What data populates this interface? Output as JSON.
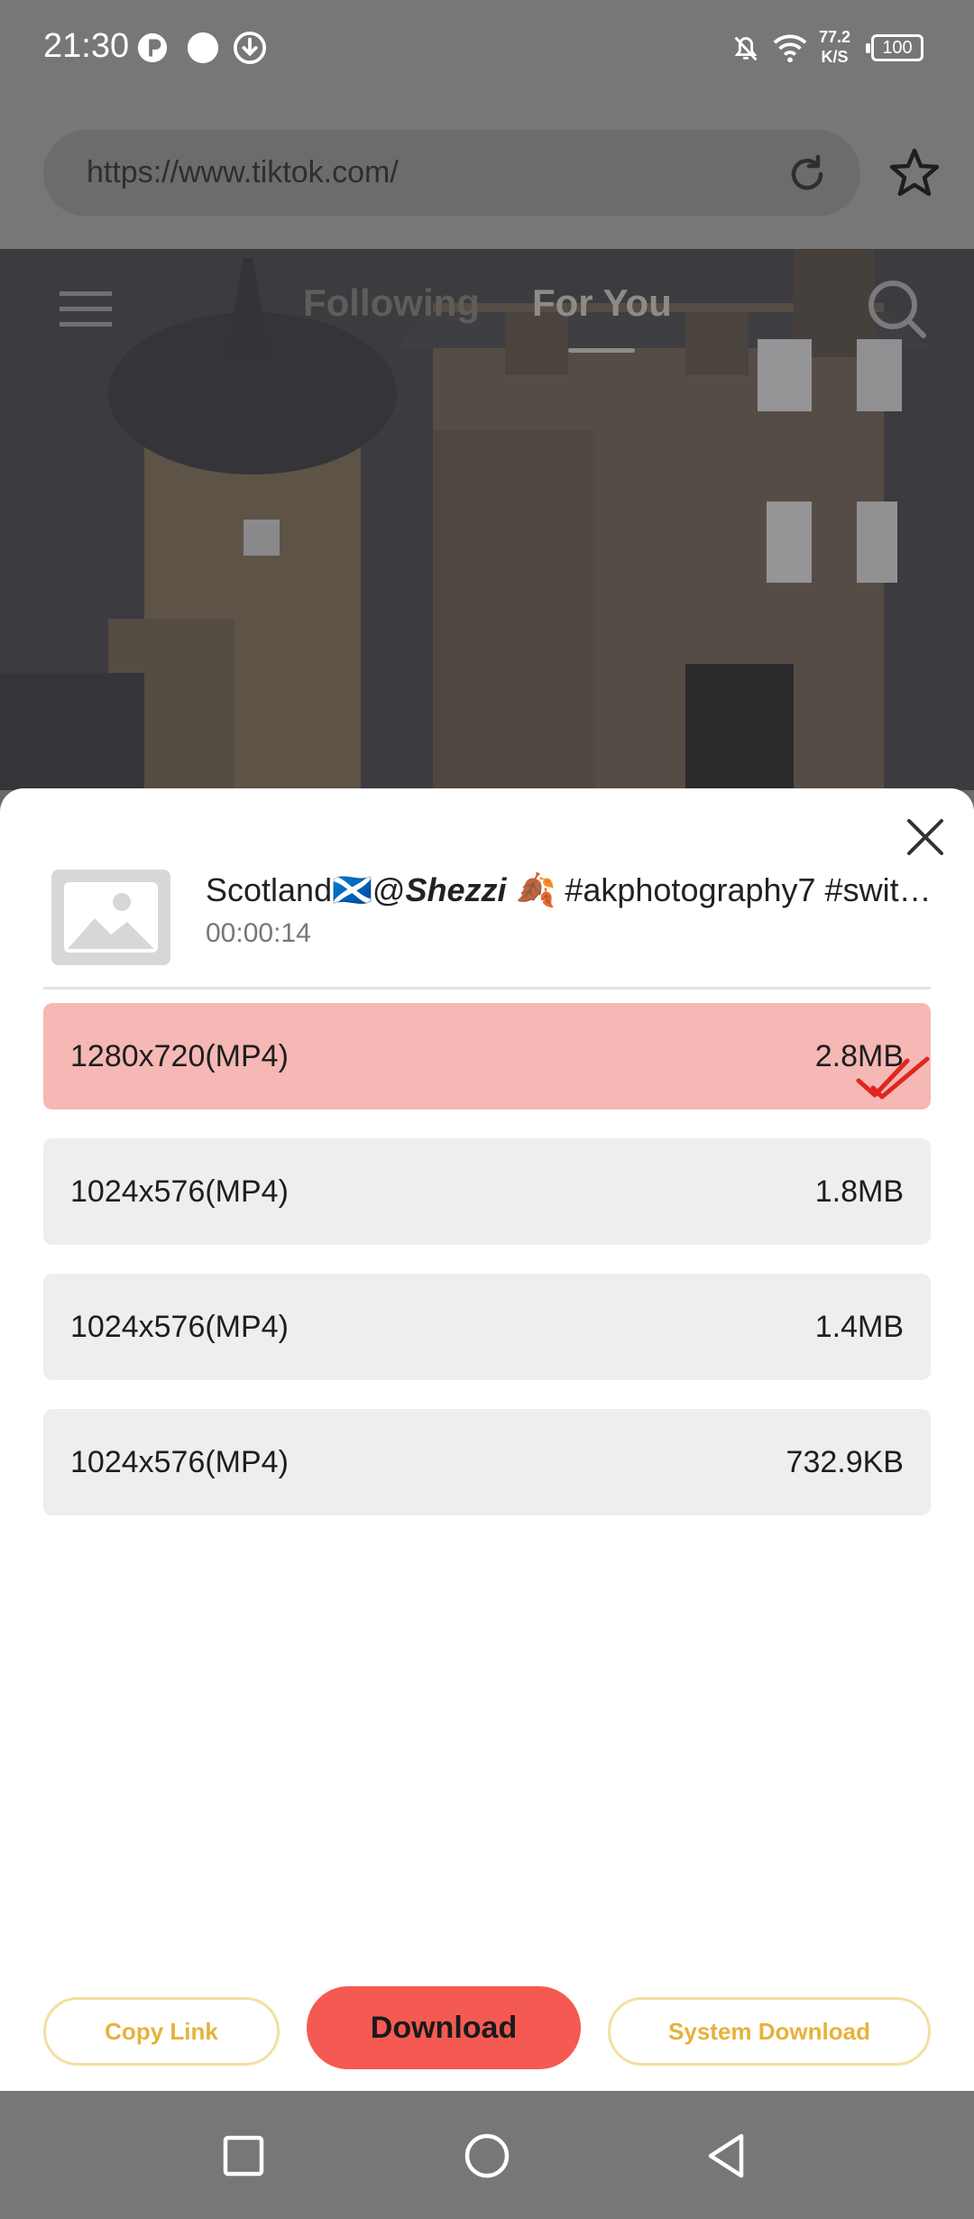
{
  "status_bar": {
    "time": "21:30",
    "net_speed_value": "77.2",
    "net_speed_unit": "K/S",
    "battery": "100",
    "icons": [
      "app-notification-icon",
      "dot-icon",
      "download-arrow-icon",
      "mute-bell-icon",
      "wifi-icon",
      "battery-icon"
    ]
  },
  "browser": {
    "url": "https://www.tiktok.com/",
    "reload_icon": "reload-icon",
    "bookmark_icon": "star-icon"
  },
  "tiktok_header": {
    "tab_following": "Following",
    "tab_for_you": "For You",
    "active_tab": "For You"
  },
  "sheet": {
    "title_prefix": "Scotland🏴󠁧󠁢󠁳󠁣󠁴󠁿@",
    "title_user": "Shezzi",
    "title_suffix": " 🍂 #akphotography7 #swit…",
    "duration": "00:00:14",
    "options": [
      {
        "resolution": "1280x720(MP4)",
        "size": "2.8MB",
        "selected": true
      },
      {
        "resolution": "1024x576(MP4)",
        "size": "1.8MB",
        "selected": false
      },
      {
        "resolution": "1024x576(MP4)",
        "size": "1.4MB",
        "selected": false
      },
      {
        "resolution": "1024x576(MP4)",
        "size": "732.9KB",
        "selected": false
      }
    ],
    "copy_link": "Copy Link",
    "download": "Download",
    "system_download": "System Download"
  },
  "colors": {
    "selected_option": "#f5b8b4",
    "download_button": "#f55a52",
    "outline_button_text": "#e6b23a",
    "check_mark": "#e0261f"
  },
  "nav_bar": {
    "icons": [
      "recent-apps-icon",
      "home-icon",
      "back-icon"
    ]
  }
}
